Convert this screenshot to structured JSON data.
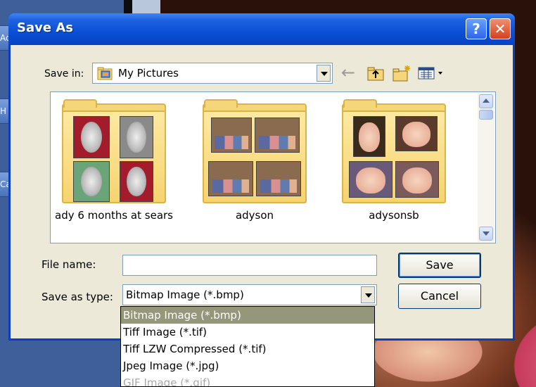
{
  "window": {
    "title": "Save As"
  },
  "titlebar": {
    "help_symbol": "?",
    "close_symbol": "✕"
  },
  "background": {
    "edge_labels": [
      "Ac",
      "H",
      "Ca"
    ]
  },
  "toolbar": {
    "save_in_label": "Save in:",
    "save_in_value": "My Pictures",
    "icons": [
      "back-icon",
      "up-folder-icon",
      "new-folder-icon",
      "views-menu-icon"
    ]
  },
  "files": [
    {
      "name": "ady 6 months at sears"
    },
    {
      "name": "adyson"
    },
    {
      "name": "adysonsb"
    }
  ],
  "form": {
    "file_name_label": "File name:",
    "file_name_value": "",
    "save_as_type_label": "Save as type:",
    "save_as_type_value": "Bitmap Image (*.bmp)",
    "save_button": "Save",
    "cancel_button": "Cancel"
  },
  "type_options": [
    "Bitmap Image (*.bmp)",
    "Tiff Image (*.tif)",
    "Tiff LZW Compressed (*.tif)",
    "Jpeg Image (*.jpg)",
    "GIF Image (*.gif)"
  ],
  "colors": {
    "titlebar": "#0a4fd6",
    "dialog_bg": "#ece9d8",
    "selected_option": "#94977a",
    "folder": "#f5d678"
  }
}
